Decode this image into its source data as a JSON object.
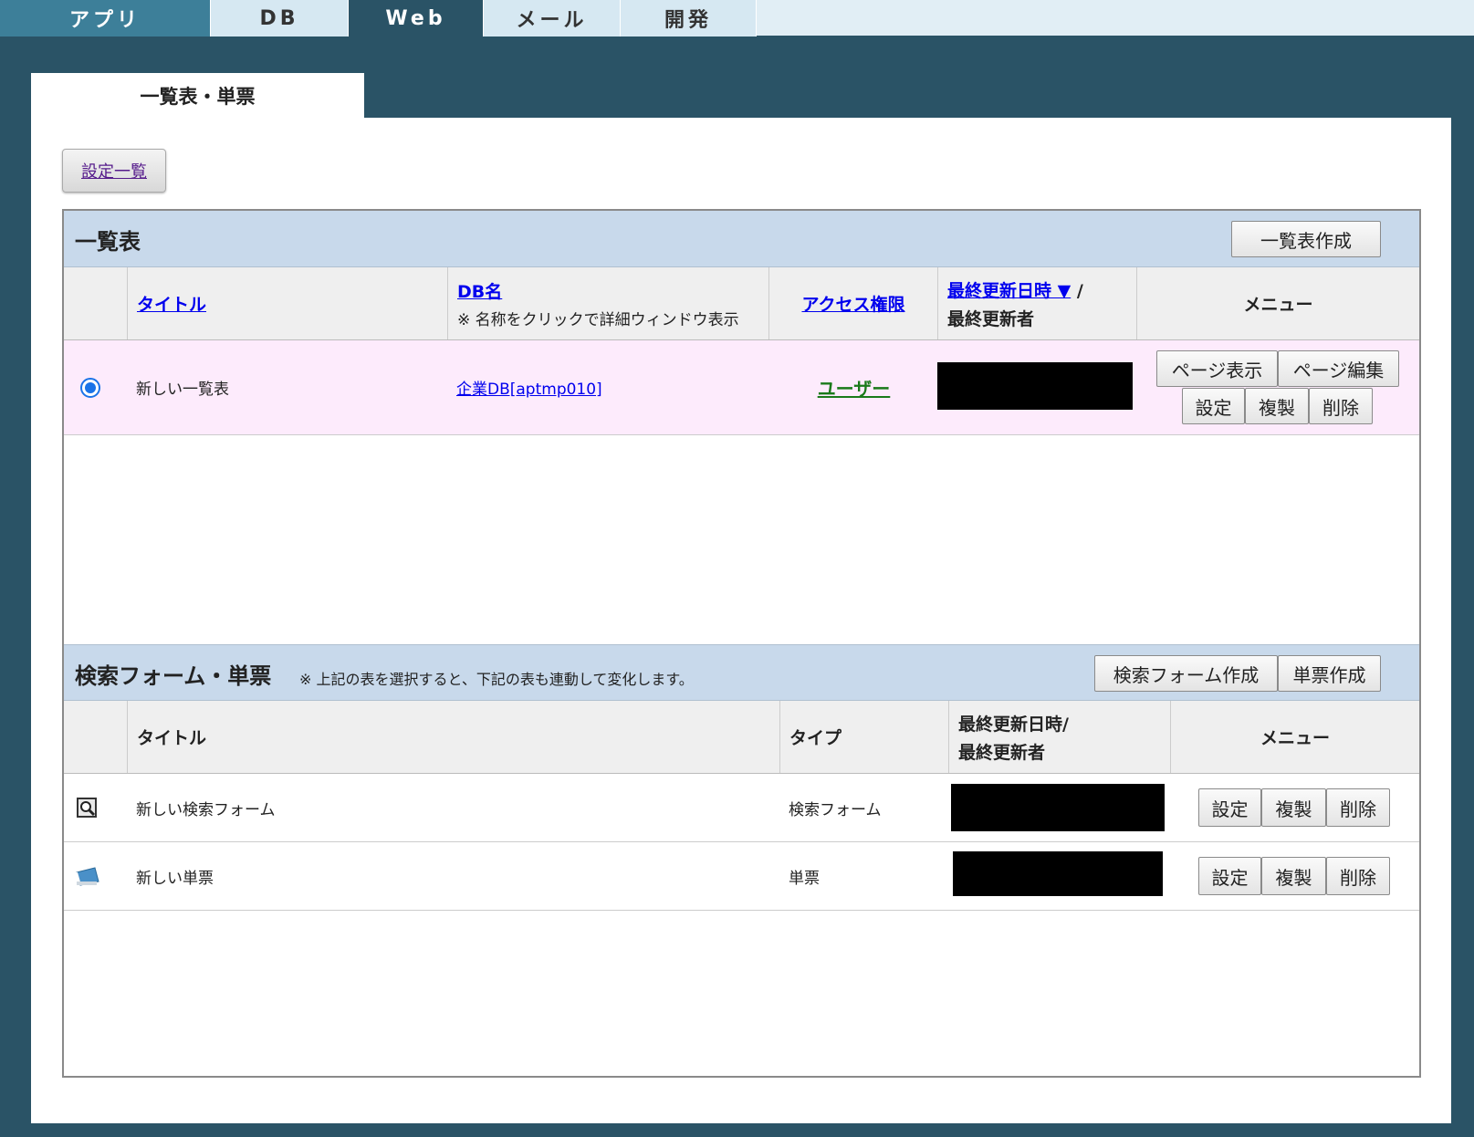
{
  "topnav": {
    "tabs": [
      "アプリ",
      "DB",
      "Web",
      "メール",
      "開発"
    ],
    "active": "Web"
  },
  "subtab": {
    "label": "一覧表・単票"
  },
  "settings_list_label": "設定一覧",
  "list_section": {
    "title": "一覧表",
    "create_button": "一覧表作成",
    "headers": {
      "title": "タイトル",
      "db_name": "DB名",
      "db_name_note": "※ 名称をクリックで詳細ウィンドウ表示",
      "access": "アクセス権限",
      "updated_at": "最終更新日時 ▼",
      "updated_sep": "/",
      "updated_by": "最終更新者",
      "menu": "メニュー"
    },
    "rows": [
      {
        "title": "新しい一覧表",
        "db_name": "企業DB[aptmp010]",
        "access": "ユーザー",
        "buttons": {
          "page_view": "ページ表示",
          "page_edit": "ページ編集",
          "settings": "設定",
          "copy": "複製",
          "delete": "削除"
        }
      }
    ]
  },
  "form_section": {
    "title": "検索フォーム・単票",
    "note": "※ 上記の表を選択すると、下記の表も連動して変化します。",
    "create_search_button": "検索フォーム作成",
    "create_card_button": "単票作成",
    "headers": {
      "title": "タイトル",
      "type": "タイプ",
      "updated_at": "最終更新日時/",
      "updated_by": "最終更新者",
      "menu": "メニュー"
    },
    "rows": [
      {
        "icon": "search-form-icon",
        "title": "新しい検索フォーム",
        "type": "検索フォーム",
        "buttons": {
          "settings": "設定",
          "copy": "複製",
          "delete": "削除"
        }
      },
      {
        "icon": "card-icon",
        "title": "新しい単票",
        "type": "単票",
        "buttons": {
          "settings": "設定",
          "copy": "複製",
          "delete": "削除"
        }
      }
    ]
  }
}
